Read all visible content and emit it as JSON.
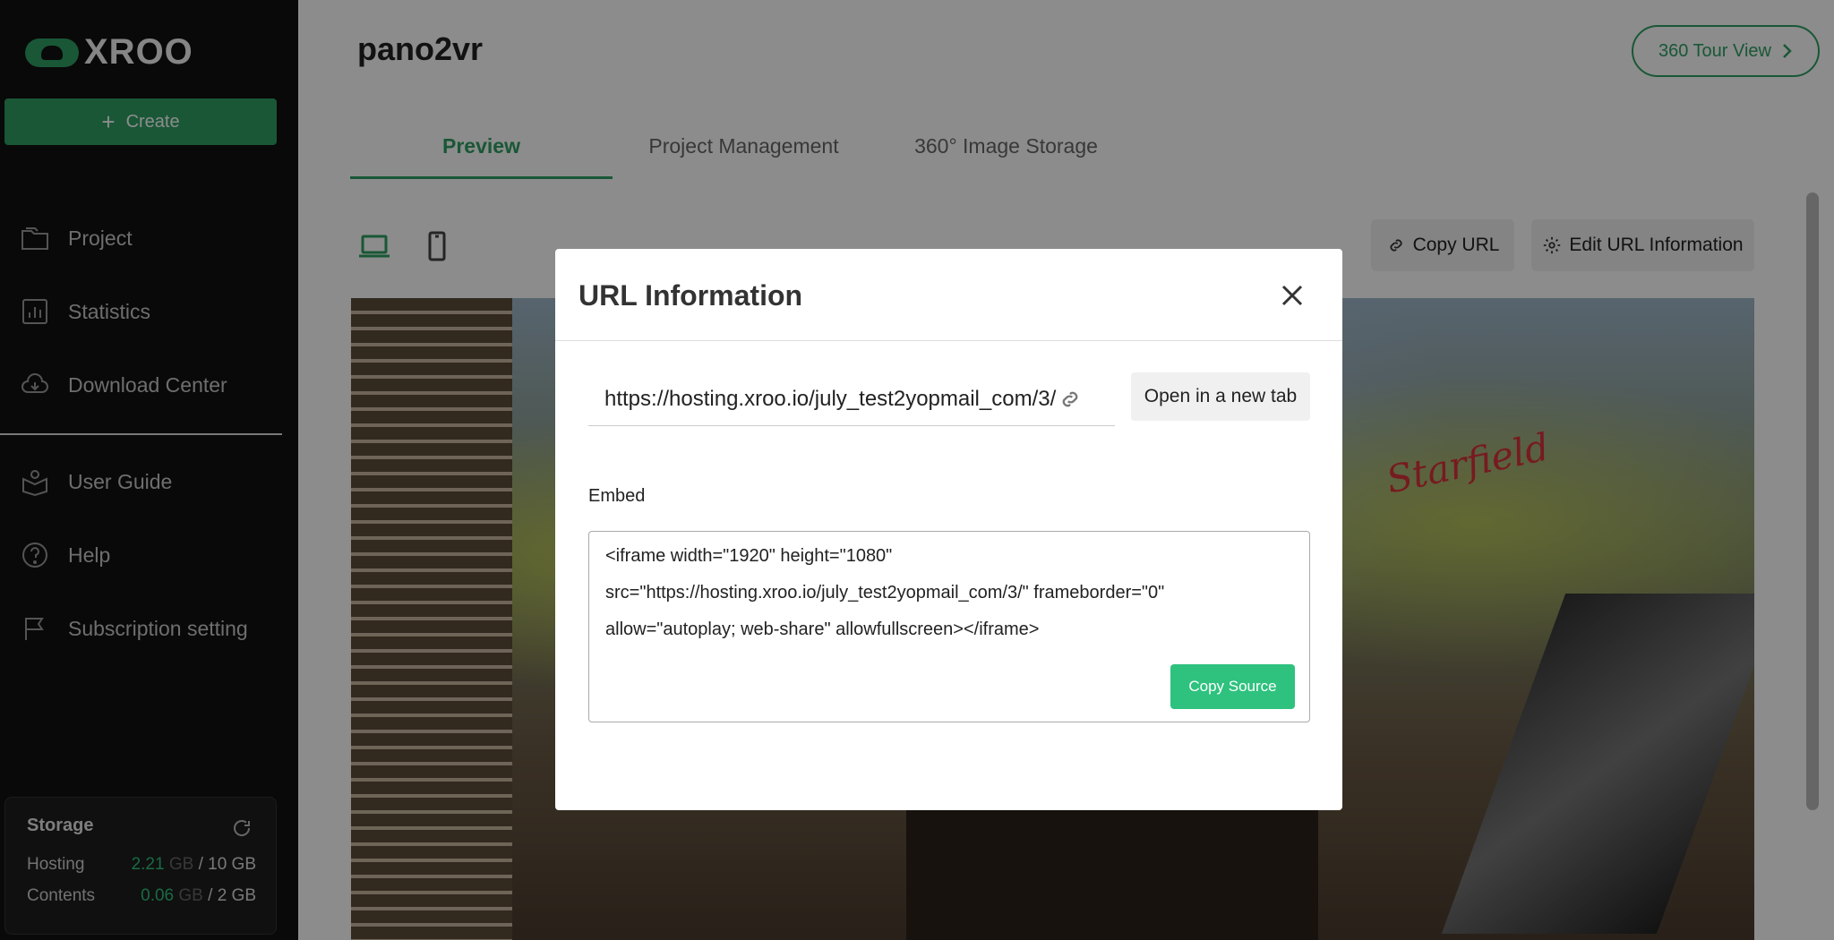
{
  "brand": {
    "name": "XROO",
    "accent": "#2e9e63"
  },
  "sidebar": {
    "create_label": "Create",
    "items": [
      {
        "label": "Project",
        "icon": "folder-icon"
      },
      {
        "label": "Statistics",
        "icon": "chart-icon"
      },
      {
        "label": "Download Center",
        "icon": "cloud-download-icon"
      },
      {
        "label": "User Guide",
        "icon": "book-user-icon"
      },
      {
        "label": "Help",
        "icon": "help-icon"
      },
      {
        "label": "Subscription setting",
        "icon": "flag-icon"
      }
    ],
    "storage": {
      "title": "Storage",
      "hosting_label": "Hosting",
      "hosting_used": "2.21",
      "hosting_unit": "GB",
      "hosting_total": "/ 10 GB",
      "contents_label": "Contents",
      "contents_used": "0.06",
      "contents_unit": "GB",
      "contents_total": "/ 2 GB"
    }
  },
  "header": {
    "title": "pano2vr",
    "tour_button": "360 Tour View"
  },
  "tabs": [
    {
      "label": "Preview",
      "active": true
    },
    {
      "label": "Project Management",
      "active": false
    },
    {
      "label": "360° Image Storage",
      "active": false
    }
  ],
  "toolbar": {
    "copy_url": "Copy URL",
    "edit_url": "Edit URL Information"
  },
  "modal": {
    "title": "URL Information",
    "url": "https://hosting.xroo.io/july_test2yopmail_com/3/",
    "open_tab": "Open in a new tab",
    "embed_label": "Embed",
    "embed_lines": [
      "<iframe width=\"1920\" height=\"1080\"",
      "src=\"https://hosting.xroo.io/july_test2yopmail_com/3/\" frameborder=\"0\"",
      "allow=\"autoplay; web-share\" allowfullscreen></iframe>"
    ],
    "copy_source": "Copy Source"
  }
}
